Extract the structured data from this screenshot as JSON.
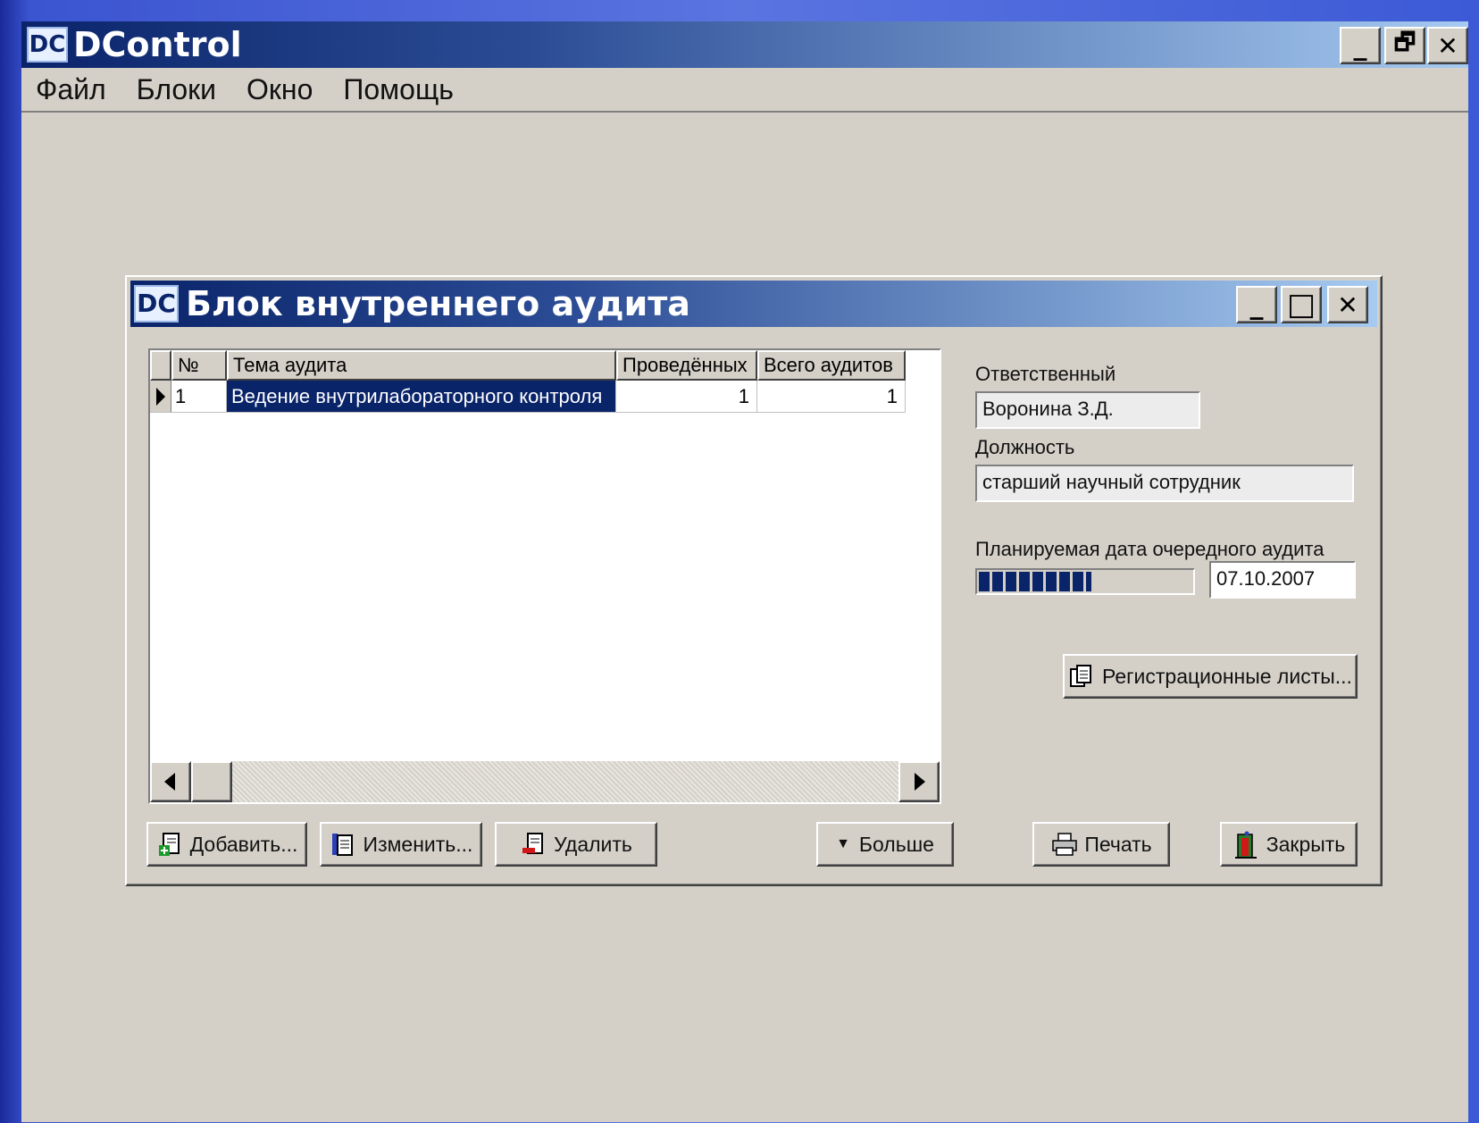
{
  "app": {
    "logo": "DC",
    "title": "DControl",
    "controls": {
      "minimize": "_",
      "restore": "🗗",
      "close": "✕"
    }
  },
  "menu": [
    "Файл",
    "Блоки",
    "Окно",
    "Помощь"
  ],
  "dialog": {
    "logo": "DC",
    "title": "Блок внутреннего аудита",
    "controls": {
      "minimize": "_",
      "maximize": "□",
      "close": "✕"
    }
  },
  "grid": {
    "columns": [
      "№",
      "Тема аудита",
      "Проведённых",
      "Всего аудитов"
    ],
    "rows": [
      {
        "num": "1",
        "topic": "Ведение внутрилабораторного контроля",
        "done": "1",
        "total": "1"
      }
    ]
  },
  "form": {
    "responsible_label": "Ответственный",
    "responsible_value": "Воронина З.Д.",
    "position_label": "Должность",
    "position_value": "старший научный сотрудник",
    "planned_date_label": "Планируемая дата очередного аудита",
    "planned_date_value": "07.10.2007",
    "date_progress_fraction": 0.53,
    "registration_button": "Регистрационные листы..."
  },
  "buttons": {
    "add": "Добавить...",
    "edit": "Изменить...",
    "delete": "Удалить",
    "more": "Больше",
    "print": "Печать",
    "close": "Закрыть"
  },
  "colors": {
    "window_bg": "#d4d0c8",
    "title_dark": "#0a246a",
    "title_light": "#a6caf0",
    "selection": "#0a246a",
    "progress": "#0a246a"
  }
}
